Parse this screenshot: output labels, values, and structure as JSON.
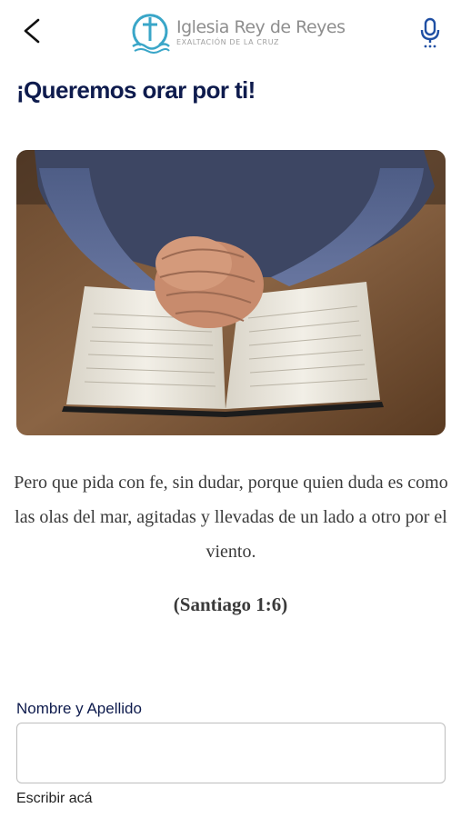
{
  "header": {
    "logo_name": "Iglesia Rey de Reyes",
    "logo_subtitle": "EXALTACIÓN DE LA CRUZ",
    "back_icon": "chevron-left-icon",
    "mic_icon": "microphone-icon",
    "brand_color": "#3aa6c8"
  },
  "main": {
    "title": "¡Queremos orar por ti!",
    "title_color": "#0e1b4d",
    "verse": "Pero que pida con fe, sin dudar, porque quien duda es como las olas del mar, agitadas y llevadas de un lado a otro por el viento.",
    "verse_reference": "(Santiago 1:6)"
  },
  "form": {
    "name_label": "Nombre y Apellido",
    "name_value": "",
    "name_hint": "Escribir acá"
  }
}
